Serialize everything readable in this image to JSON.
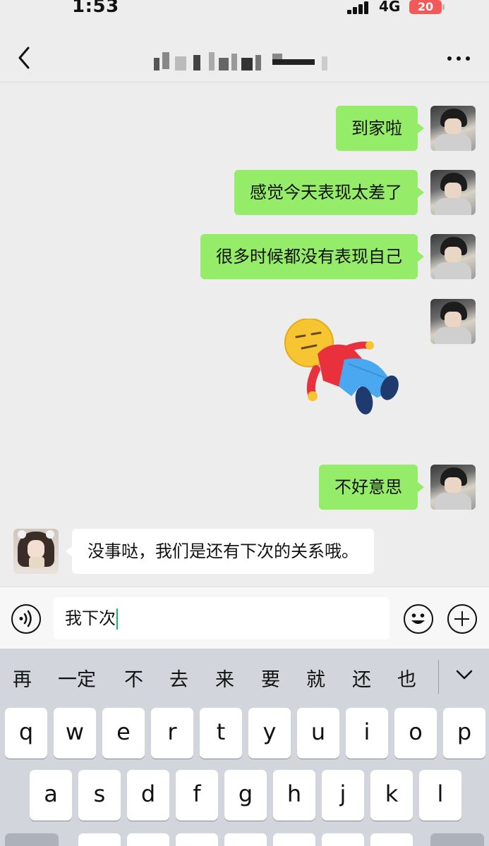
{
  "status_bar": {
    "time": "1:53",
    "network": "4G",
    "battery": "20"
  },
  "header": {
    "back_icon": "chevron-left-icon",
    "more_icon": "more-dots-icon",
    "title_obscured": true
  },
  "messages": [
    {
      "side": "self",
      "type": "text",
      "text": "到家啦"
    },
    {
      "side": "self",
      "type": "text",
      "text": "感觉今天表现太差了"
    },
    {
      "side": "self",
      "type": "text",
      "text": "很多时候都没有表现自己"
    },
    {
      "side": "self",
      "type": "sticker",
      "sticker": "lying-down-emoji-sticker"
    },
    {
      "side": "self",
      "type": "text",
      "text": "不好意思"
    },
    {
      "side": "other",
      "type": "text",
      "text": "没事哒，我们是还有下次的关系哦。"
    }
  ],
  "input_bar": {
    "value": "我下次",
    "voice_icon": "voice-icon",
    "emoji_icon": "emoji-icon",
    "plus_icon": "plus-icon"
  },
  "keyboard": {
    "candidates": [
      "再",
      "一定",
      "不",
      "去",
      "来",
      "要",
      "就",
      "还",
      "也"
    ],
    "row1": [
      "q",
      "w",
      "e",
      "r",
      "t",
      "y",
      "u",
      "i",
      "o",
      "p"
    ],
    "row2": [
      "a",
      "s",
      "d",
      "f",
      "g",
      "h",
      "j",
      "k",
      "l"
    ]
  },
  "colors": {
    "self_bubble": "#95ec69",
    "other_bubble": "#ffffff",
    "background": "#ededed",
    "keyboard": "#d2d5db",
    "caret": "#07c160",
    "battery": "#f25a5a"
  }
}
